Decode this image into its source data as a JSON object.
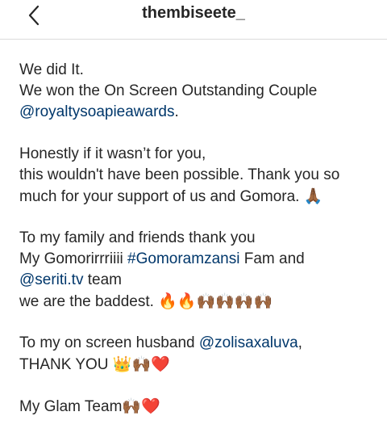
{
  "header": {
    "username": "thembiseete_",
    "back_icon": "chevron-left-icon"
  },
  "caption": {
    "l1": "We did It.",
    "l2_text": "We won the On Screen Outstanding Couple",
    "l3_mention": "@royaltysoapieawards",
    "l3_text": ".",
    "l4": "Honestly if it wasn’t for you,",
    "l5": "this wouldn't have been possible. Thank you so",
    "l6_text": "much for your support of us and Gomora.",
    "l6_emoji": "🙏🏾",
    "l7": "To my family and friends thank you",
    "l8_text": "My Gomorirrriiii",
    "l8_hashtag": "#Gomoramzansi",
    "l8_text2": "Fam and",
    "l9_mention": "@seriti.tv",
    "l9_text": "team",
    "l10_text": "we are the baddest.",
    "l10_emoji": "🔥🔥🙌🏾🙌🏾🙌🏾🙌🏾",
    "l11_text": "To my on screen husband",
    "l11_mention": "@zolisaxaluva",
    "l11_text2": ",",
    "l12_text": "THANK YOU",
    "l12_emoji": "👑🙌🏾❤️",
    "l13_text": "My Glam Team",
    "l13_emoji": "🙌🏾❤️"
  },
  "colors": {
    "text": "#262626",
    "link": "#00376b",
    "divider": "#dbdbdb",
    "background": "#ffffff"
  }
}
